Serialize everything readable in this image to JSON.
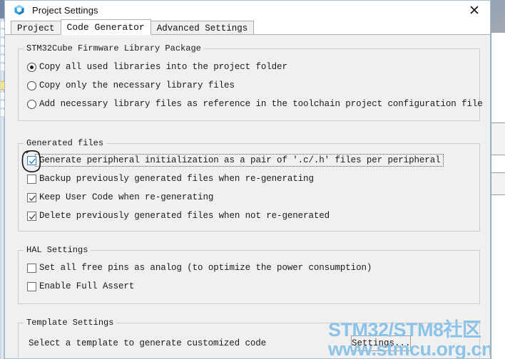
{
  "window": {
    "title": "Project Settings",
    "app_icon": "cube-icon",
    "close_label": "✕"
  },
  "tabs": [
    {
      "label": "Project",
      "active": false
    },
    {
      "label": "Code Generator",
      "active": true
    },
    {
      "label": "Advanced Settings",
      "active": false
    }
  ],
  "groups": {
    "firmware": {
      "title": "STM32Cube Firmware Library Package",
      "options": [
        {
          "label": "Copy all used libraries into the project folder",
          "checked": true
        },
        {
          "label": "Copy only the necessary library files",
          "checked": false
        },
        {
          "label": "Add necessary library files as reference in the toolchain project configuration file",
          "checked": false
        }
      ]
    },
    "generated": {
      "title": "Generated files",
      "options": [
        {
          "label": "Generate peripheral initialization as a pair of '.c/.h' files per peripheral",
          "checked": true,
          "focused": true,
          "annotated": true
        },
        {
          "label": "Backup previously generated files when re-generating",
          "checked": false,
          "focused": false,
          "annotated": false
        },
        {
          "label": "Keep User Code when re-generating",
          "checked": true,
          "focused": false,
          "annotated": false
        },
        {
          "label": "Delete previously generated files when not re-generated",
          "checked": true,
          "focused": false,
          "annotated": false
        }
      ]
    },
    "hal": {
      "title": "HAL Settings",
      "options": [
        {
          "label": "Set all free pins as analog (to optimize the power consumption)",
          "checked": false
        },
        {
          "label": "Enable Full Assert",
          "checked": false
        }
      ]
    },
    "template": {
      "title": "Template Settings",
      "description": "Select a template to generate customized code",
      "settings_button": "Settings..."
    }
  },
  "watermark": {
    "line1": "STM32/STM8社区",
    "line2": "www.stmcu.org.cn",
    "color": "#8cc3e8"
  },
  "colors": {
    "dialog_background": "#f0f0f0",
    "groupbox_border": "#cbcbcb",
    "accent_blue": "#3a84c3",
    "annotation": "#111111"
  }
}
